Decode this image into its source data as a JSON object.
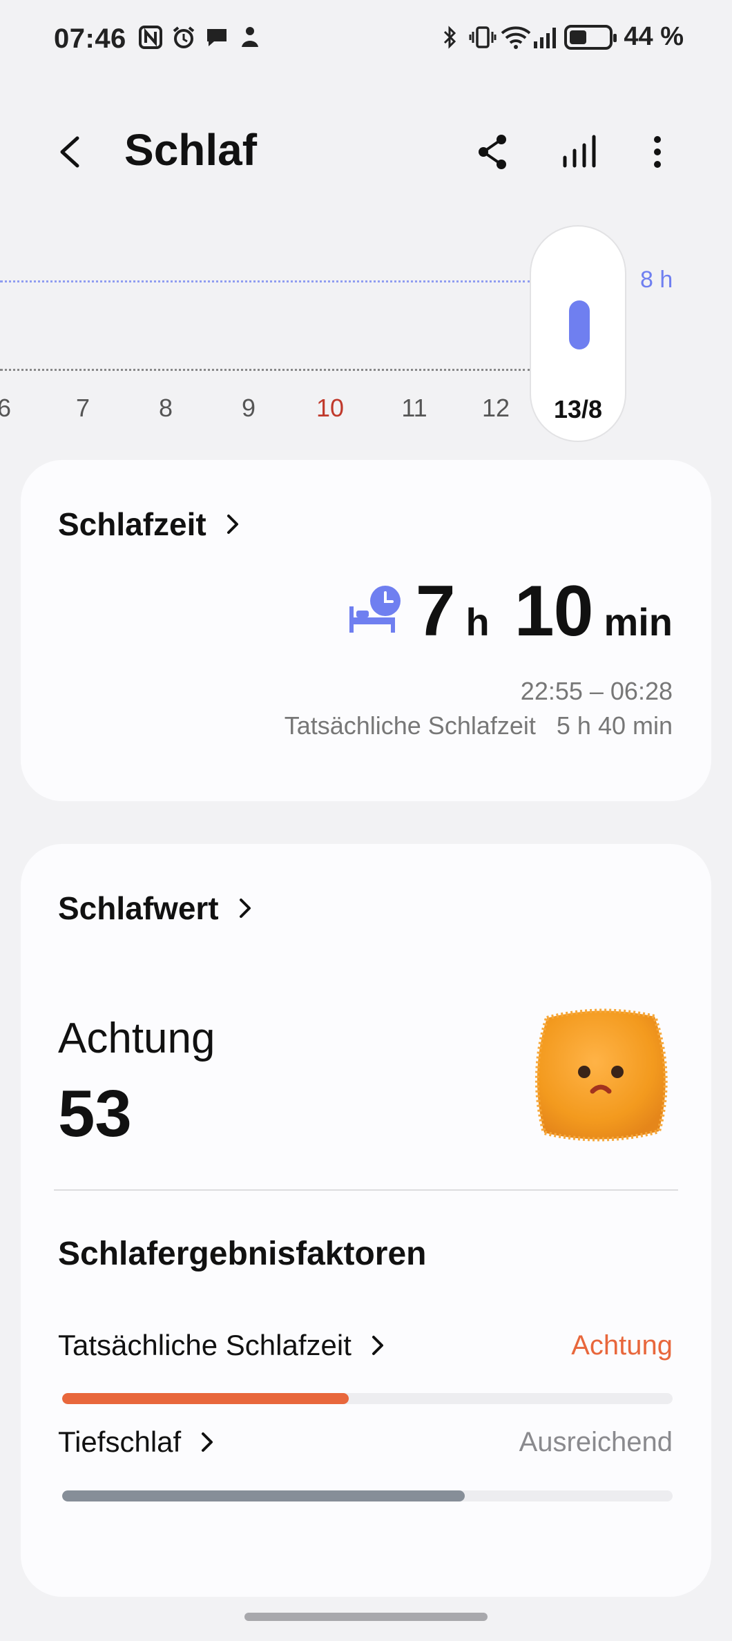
{
  "status_bar": {
    "time": "07:46",
    "battery_text": "44 %",
    "battery_level": 0.44
  },
  "header": {
    "title": "Schlaf"
  },
  "timeline": {
    "goal_label": "8 h",
    "days": [
      "6",
      "7",
      "8",
      "9",
      "10",
      "11",
      "12"
    ],
    "highlighted_day": "10",
    "selected_label": "13/8",
    "selected_hours": 7.17,
    "goal_hours": 8,
    "colors": {
      "accent": "#6f7ff0",
      "highlight_day": "#c0392b"
    }
  },
  "sleep_time_card": {
    "title": "Schlafzeit",
    "hours": "7",
    "hours_unit": "h",
    "minutes": "10",
    "minutes_unit": "min",
    "range": "22:55 – 06:28",
    "actual": "Tatsächliche Schlafzeit   5 h 40 min"
  },
  "sleep_score_card": {
    "title": "Schlafwert",
    "status": "Achtung",
    "score": "53",
    "factors_title": "Schlafergebnisfaktoren",
    "factors": [
      {
        "name": "Tatsächliche Schlafzeit",
        "status": "Achtung",
        "level": 0.47,
        "color": "#e8673c",
        "status_color": "#e8673c"
      },
      {
        "name": "Tiefschlaf",
        "status": "Ausreichend",
        "level": 0.66,
        "color": "#868e98",
        "status_color": "#8a8a8e"
      }
    ]
  }
}
